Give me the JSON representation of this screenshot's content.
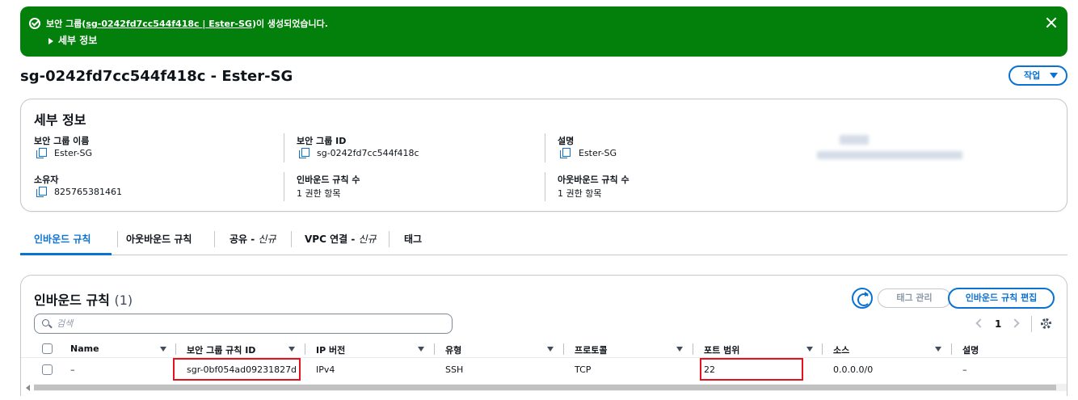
{
  "flash": {
    "message_prefix": "보안 그룹(",
    "message_link": "sg-0242fd7cc544f418c | Ester-SG",
    "message_suffix": ")이 생성되었습니다.",
    "details_label": "세부 정보",
    "color": "#037f0c"
  },
  "page": {
    "title": "sg-0242fd7cc544f418c - Ester-SG",
    "actions_label": "작업"
  },
  "details": {
    "title": "세부 정보",
    "items": [
      {
        "label": "보안 그룹 이름",
        "value": "Ester-SG",
        "copyable": true
      },
      {
        "label": "보안 그룹 ID",
        "value": "sg-0242fd7cc544f418c",
        "copyable": true
      },
      {
        "label": "설명",
        "value": "Ester-SG",
        "copyable": true
      },
      {
        "label": "소유자",
        "value": "825765381461",
        "copyable": true
      },
      {
        "label": "인바운드 규칙 수",
        "value": "1 권한 항목",
        "copyable": false
      },
      {
        "label": "아웃바운드 규칙 수",
        "value": "1 권한 항목",
        "copyable": false
      }
    ]
  },
  "tabs": [
    {
      "label": "인바운드 규칙",
      "suffix": "",
      "active": true
    },
    {
      "label": "아웃바운드 규칙",
      "suffix": "",
      "active": false
    },
    {
      "label": "공유 - ",
      "suffix": "신규",
      "active": false
    },
    {
      "label": "VPC 연결 - ",
      "suffix": "신규",
      "active": false
    },
    {
      "label": "태그",
      "suffix": "",
      "active": false
    }
  ],
  "rules": {
    "title": "인바운드 규칙",
    "count": "(1)",
    "manage_tags_label": "태그 관리",
    "edit_label": "인바운드 규칙 편집",
    "search_placeholder": "검색",
    "page_number": "1",
    "columns": [
      "Name",
      "보안 그룹 규칙 ID",
      "IP 버전",
      "유형",
      "프로토콜",
      "포트 범위",
      "소스",
      "설명"
    ],
    "rows": [
      {
        "name": "–",
        "rule_id": "sgr-0bf054ad09231827d",
        "ip_version": "IPv4",
        "type": "SSH",
        "protocol": "TCP",
        "port_range": "22",
        "source": "0.0.0.0/0",
        "description": "–"
      }
    ]
  },
  "colors": {
    "accent": "#0972d3",
    "highlight": "#e8101b",
    "success": "#037f0c"
  }
}
